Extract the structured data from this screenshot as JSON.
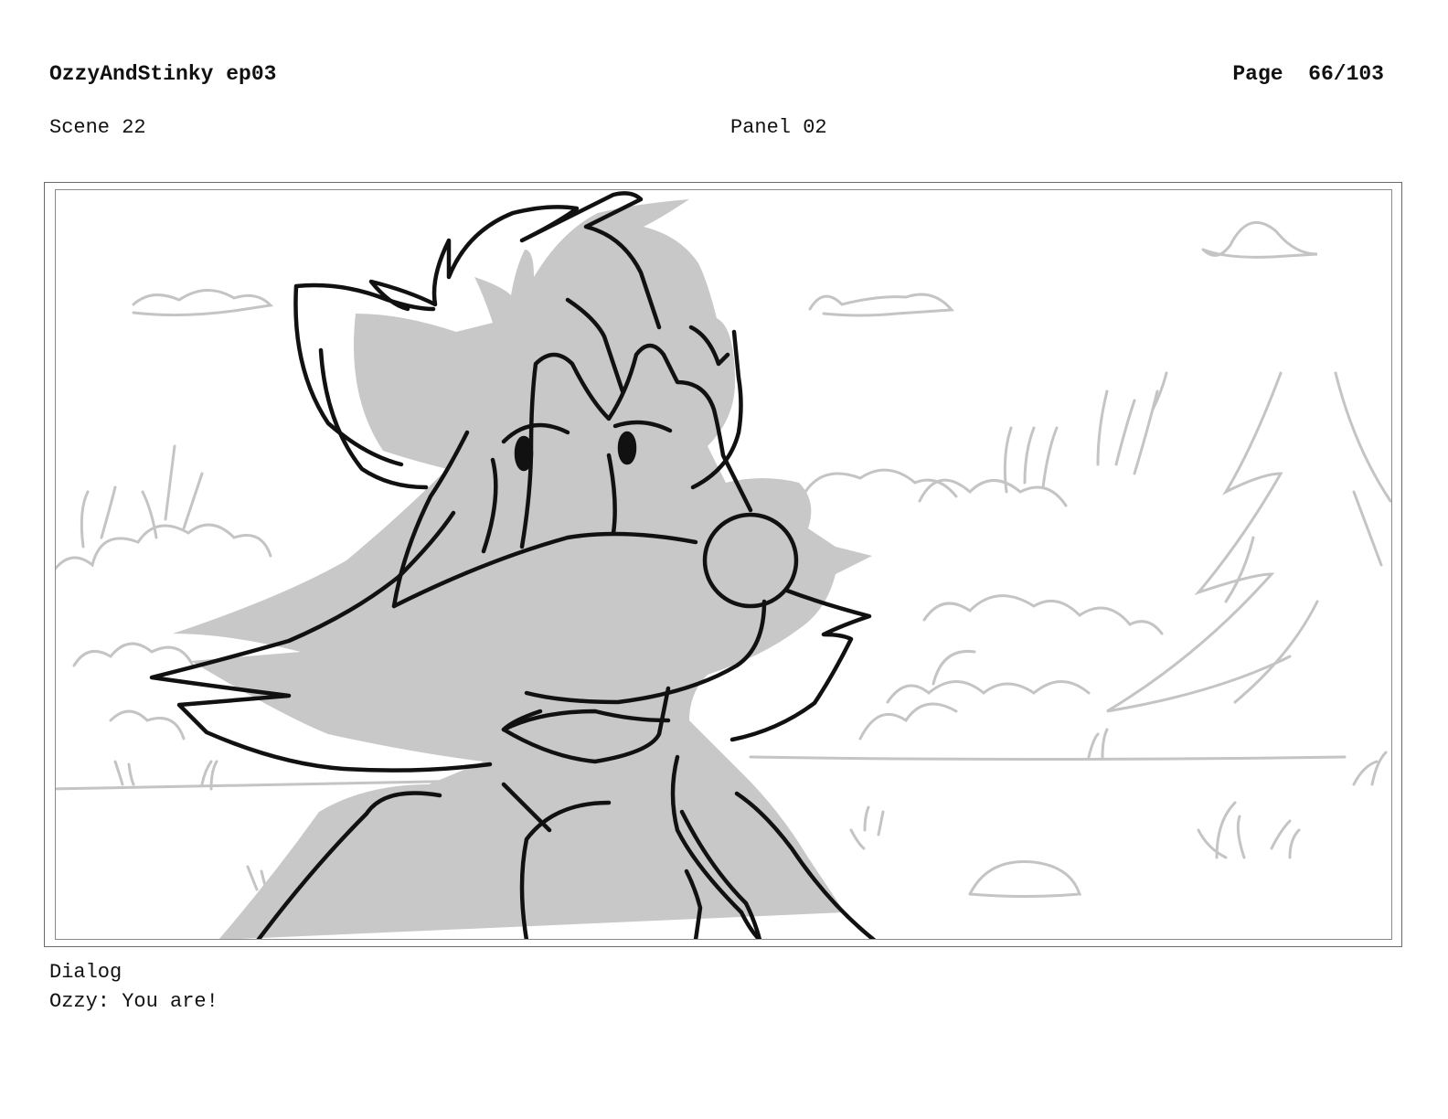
{
  "header": {
    "title": "OzzyAndStinky ep03",
    "page_label": "Page",
    "page_number": "66/103"
  },
  "meta": {
    "scene": "Scene 22",
    "panel": "Panel 02"
  },
  "panel_art": {
    "icon": "skunk-character-sketch-icon",
    "fill_color": "#c8c8c8",
    "line_color": "#111111",
    "background_line_color": "#c4c4c4"
  },
  "dialog": {
    "label": "Dialog",
    "lines": [
      "Ozzy: You are!"
    ]
  }
}
